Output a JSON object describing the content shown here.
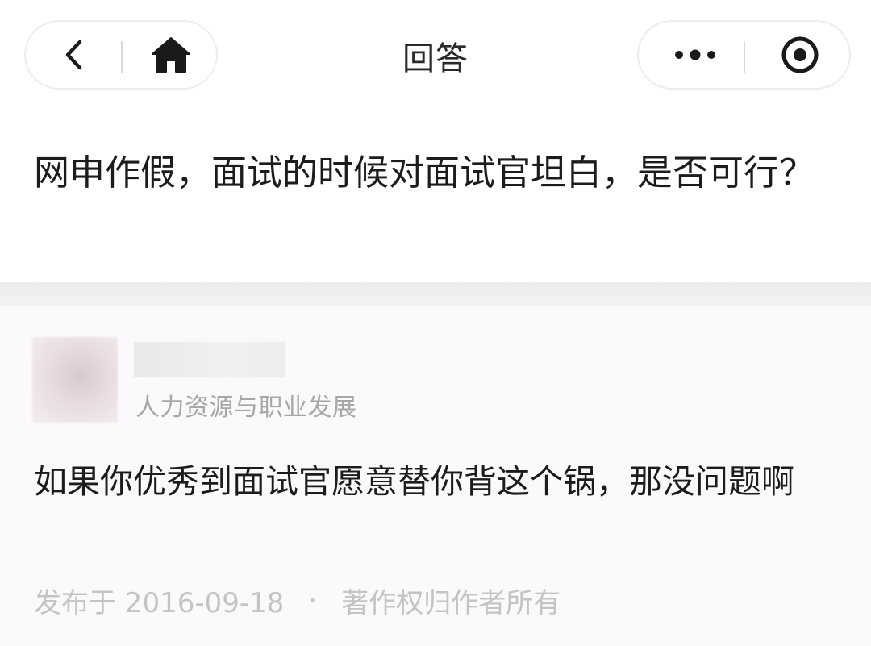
{
  "nav": {
    "title": "回答",
    "back_icon": "chevron-left-icon",
    "home_icon": "home-icon",
    "more_icon": "more-dots-icon",
    "close_icon": "target-circle-icon"
  },
  "question": {
    "text": "网申作假，面试的时候对面试官坦白，是否可行？"
  },
  "answer": {
    "author_tag": "人力资源与职业发展",
    "text": "如果你优秀到面试官愿意替你背这个锅，那没问题啊",
    "published": "发布于 2016-09-18",
    "separator": "·",
    "copyright": "著作权归作者所有"
  },
  "colors": {
    "background": "#ffffff",
    "answer_background": "#fbf9fb",
    "text_primary": "#1c1c1c",
    "text_muted": "#a7a7a7",
    "text_meta": "#c4c4c4"
  }
}
